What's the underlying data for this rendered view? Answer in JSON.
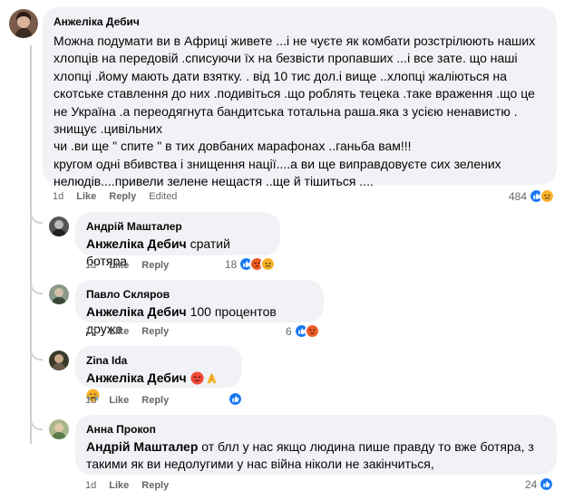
{
  "comments": [
    {
      "author": "Анжеліка Дебич",
      "text": "Можна подумати ви в Африці живете ...і не чуєте як комбати розстрілюють наших хлопців на передовій .списуючи їх на безвісти пропавших ...і все зате. що наші хлопці .йому мають дати взятку. . від 10 тис дол.і вище ..хлопці жаліються на скотське ставлення до них .подивіться .що роблять тецека .таке враження .що це не Україна .а переодягнута бандитська тотальна раша.яка з усією ненавистю . знищує .цивільних\nчи .ви ще \" спите \" в тих довбаних марафонах ..ганьба вам!!!\nкругом одні вбивства і знищення нації....а ви ще виправдовуєте сих зелених нелюдів....привели зелене нещастя ..ще й тішиться ....",
      "time": "1d",
      "like": "Like",
      "reply": "Reply",
      "edited": "Edited",
      "reaction_count": "484"
    }
  ],
  "replies": [
    {
      "author": "Андрій Машталер",
      "mention": "Анжеліка Дебич",
      "text": " сратий ботяра",
      "time": "1d",
      "like": "Like",
      "reply": "Reply",
      "reaction_count": "18"
    },
    {
      "author": "Павло Скляров",
      "mention": "Анжеліка Дебич",
      "text": " 100 процентов друже",
      "time": "1d",
      "like": "Like",
      "reply": "Reply",
      "reaction_count": "6"
    },
    {
      "author": "Zina Ida",
      "mention": "Анжеліка Дебич",
      "text": "",
      "time": "1d",
      "like": "Like",
      "reply": "Reply",
      "reaction_count": ""
    },
    {
      "author": "Анна Прокоп",
      "mention": "Андрій Машталер",
      "text": " от блл у нас якщо людина пише правду то вже ботяра, з такими як ви недолугими у нас війна ніколи не закінчиться,",
      "time": "1d",
      "like": "Like",
      "reply": "Reply",
      "reaction_count": "24"
    }
  ],
  "colors": {
    "bubble": "#f0f2f5",
    "meta": "#65676b",
    "like_blue": "#1877f2",
    "angry": "#e9710f",
    "sad": "#f7b125",
    "thread": "#ced0d4"
  }
}
